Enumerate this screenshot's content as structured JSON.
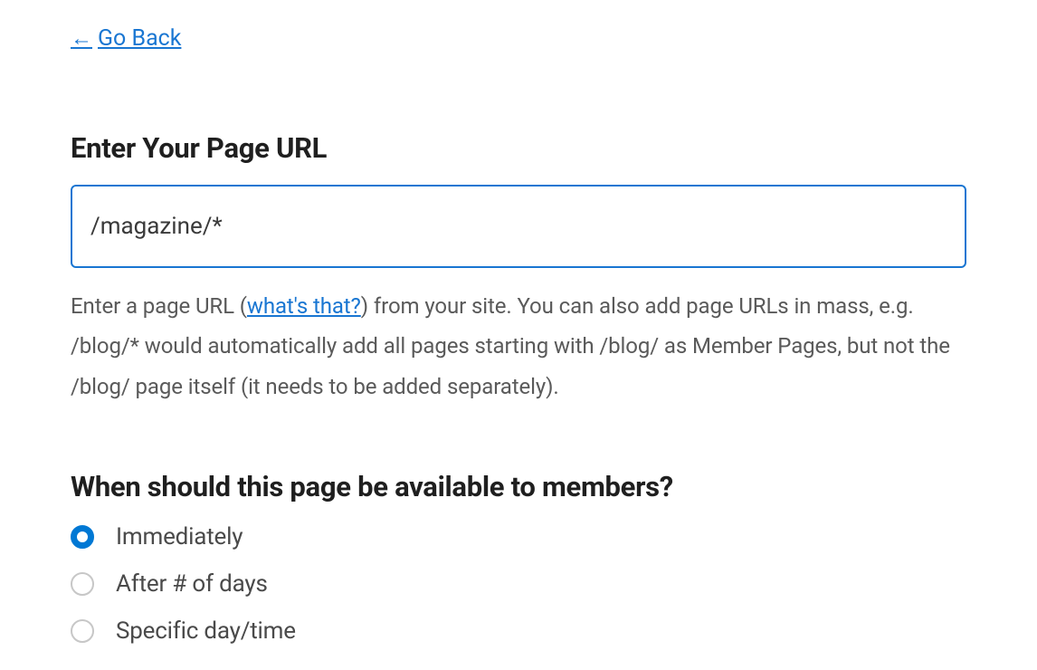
{
  "nav": {
    "go_back_label": "Go Back",
    "go_back_arrow": "←"
  },
  "url_section": {
    "heading": "Enter Your Page URL",
    "input_value": "/magazine/*",
    "helper_prefix": "Enter a page URL (",
    "whats_that_link": "what's that?",
    "helper_suffix": ") from your site. You can also add page URLs in mass, e.g. /blog/* would automatically add all pages starting with /blog/ as Member Pages, but not the /blog/ page itself (it needs to be added separately)."
  },
  "availability_section": {
    "heading": "When should this page be available to members?",
    "options": [
      {
        "label": "Immediately",
        "selected": true
      },
      {
        "label": "After # of days",
        "selected": false
      },
      {
        "label": "Specific day/time",
        "selected": false
      }
    ]
  }
}
